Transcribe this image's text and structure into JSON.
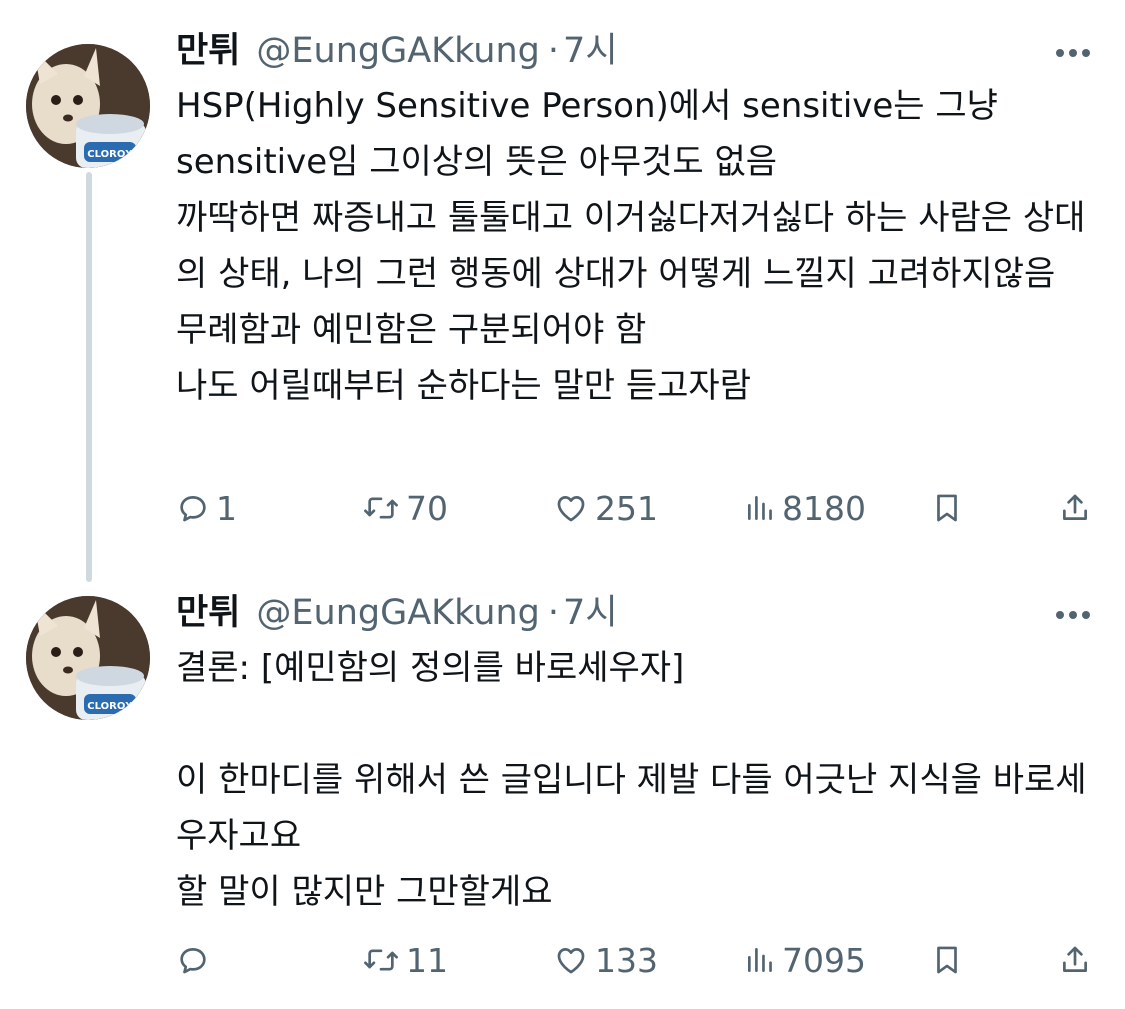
{
  "tweets": [
    {
      "author_name": "만튀",
      "handle": "@EungGAKkung",
      "separator": "·",
      "time": "7시",
      "text": "HSP(Highly Sensitive Person)에서 sensitive는 그냥 sensitive임 그이상의 뜻은 아무것도 없음\n까딱하면 짜증내고 툴툴대고 이거싫다저거싫다 하는 사람은 상대의 상태, 나의 그런 행동에 상대가 어떻게 느낄지 고려하지않음\n무례함과 예민함은 구분되어야 함\n나도 어릴때부터 순하다는 말만 듣고자람",
      "replies": "1",
      "retweets": "70",
      "likes": "251",
      "views": "8180"
    },
    {
      "author_name": "만튀",
      "handle": "@EungGAKkung",
      "separator": "·",
      "time": "7시",
      "text": "결론: [예민함의 정의를 바로세우자]\n\n이 한마디를 위해서 쓴 글입니다 제발 다들 어긋난 지식을 바로세우자고요\n할 말이 많지만 그만할게요",
      "replies": "",
      "retweets": "11",
      "likes": "133",
      "views": "7095"
    }
  ],
  "icons": {
    "more": "more-horizontal-icon",
    "reply": "reply-icon",
    "retweet": "retweet-icon",
    "like": "heart-icon",
    "views": "views-chart-icon",
    "bookmark": "bookmark-icon",
    "share": "share-icon"
  },
  "colors": {
    "text_primary": "#0f1419",
    "text_secondary": "#536471",
    "thread_line": "#cfd9de"
  }
}
